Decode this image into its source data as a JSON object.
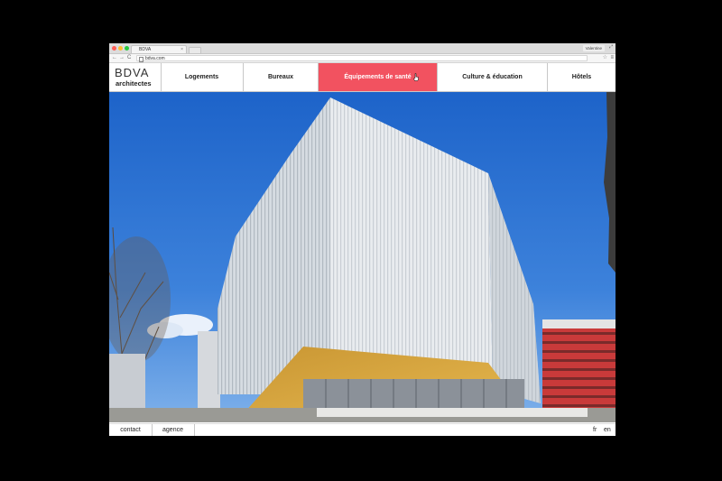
{
  "browser": {
    "tab_title": "BDVA",
    "tab_close": "×",
    "profile": "Valentine",
    "window_controls": "⤢",
    "url": "bdva.com",
    "back": "←",
    "forward": "→",
    "reload": "C",
    "star": "☆",
    "menu": "≡",
    "traffic_colors": [
      "#ff5f57",
      "#ffbd2e",
      "#28c940"
    ]
  },
  "site": {
    "logo_mark": "BDVA",
    "logo_sub": "architectes",
    "nav": [
      {
        "label": "Logements"
      },
      {
        "label": "Bureaux"
      },
      {
        "label": "Équipements de santé",
        "active": true
      },
      {
        "label": "Culture & éducation"
      },
      {
        "label": "Hôtels"
      }
    ],
    "accent_color": "#f25260"
  },
  "hero": {
    "icon": "building-photo",
    "subject": "white louvered facade building with golden underside"
  },
  "footer": {
    "links": [
      "contact",
      "agence"
    ],
    "languages": [
      "fr",
      "en"
    ]
  }
}
